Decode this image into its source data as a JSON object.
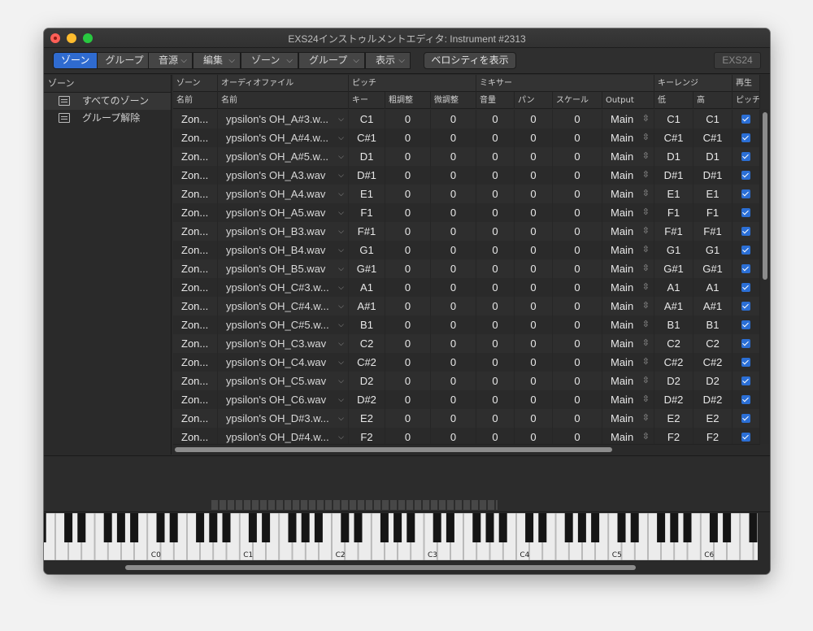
{
  "window": {
    "title": "EXS24インストゥルメントエディタ: Instrument #2313"
  },
  "toolbar": {
    "mode_tabs": [
      {
        "label": "ゾーン",
        "active": true
      },
      {
        "label": "グループ",
        "active": false
      }
    ],
    "menus": [
      "音源",
      "編集",
      "ゾーン",
      "グループ",
      "表示"
    ],
    "velocity_button": "ベロシティを表示",
    "exs_button": "EXS24"
  },
  "sidebar": {
    "header": "ゾーン",
    "items": [
      {
        "label": "すべてのゾーン",
        "icon": "zones-icon",
        "selected": true
      },
      {
        "label": "グループ解除",
        "icon": "ungrouped-icon",
        "selected": false
      }
    ]
  },
  "table": {
    "group_headers": [
      "ゾーン",
      "オーディオファイル",
      "ピッチ",
      "ミキサー",
      "キーレンジ",
      "再生"
    ],
    "column_headers": [
      "名前",
      "名前",
      "キー",
      "粗調整",
      "微調整",
      "音量",
      "パン",
      "スケール",
      "Output",
      "低",
      "高",
      "ピッチ"
    ],
    "rows": [
      {
        "zone": "Zon...",
        "file": "ypsilon's OH_A#3.w...",
        "key": "C1",
        "coarse": "0",
        "fine": "0",
        "volume": "0",
        "pan": "0",
        "scale": "0",
        "output": "Main",
        "low": "C1",
        "high": "C1",
        "pitch": true
      },
      {
        "zone": "Zon...",
        "file": "ypsilon's OH_A#4.w...",
        "key": "C#1",
        "coarse": "0",
        "fine": "0",
        "volume": "0",
        "pan": "0",
        "scale": "0",
        "output": "Main",
        "low": "C#1",
        "high": "C#1",
        "pitch": true
      },
      {
        "zone": "Zon...",
        "file": "ypsilon's OH_A#5.w...",
        "key": "D1",
        "coarse": "0",
        "fine": "0",
        "volume": "0",
        "pan": "0",
        "scale": "0",
        "output": "Main",
        "low": "D1",
        "high": "D1",
        "pitch": true
      },
      {
        "zone": "Zon...",
        "file": "ypsilon's OH_A3.wav",
        "key": "D#1",
        "coarse": "0",
        "fine": "0",
        "volume": "0",
        "pan": "0",
        "scale": "0",
        "output": "Main",
        "low": "D#1",
        "high": "D#1",
        "pitch": true
      },
      {
        "zone": "Zon...",
        "file": "ypsilon's OH_A4.wav",
        "key": "E1",
        "coarse": "0",
        "fine": "0",
        "volume": "0",
        "pan": "0",
        "scale": "0",
        "output": "Main",
        "low": "E1",
        "high": "E1",
        "pitch": true
      },
      {
        "zone": "Zon...",
        "file": "ypsilon's OH_A5.wav",
        "key": "F1",
        "coarse": "0",
        "fine": "0",
        "volume": "0",
        "pan": "0",
        "scale": "0",
        "output": "Main",
        "low": "F1",
        "high": "F1",
        "pitch": true
      },
      {
        "zone": "Zon...",
        "file": "ypsilon's OH_B3.wav",
        "key": "F#1",
        "coarse": "0",
        "fine": "0",
        "volume": "0",
        "pan": "0",
        "scale": "0",
        "output": "Main",
        "low": "F#1",
        "high": "F#1",
        "pitch": true
      },
      {
        "zone": "Zon...",
        "file": "ypsilon's OH_B4.wav",
        "key": "G1",
        "coarse": "0",
        "fine": "0",
        "volume": "0",
        "pan": "0",
        "scale": "0",
        "output": "Main",
        "low": "G1",
        "high": "G1",
        "pitch": true
      },
      {
        "zone": "Zon...",
        "file": "ypsilon's OH_B5.wav",
        "key": "G#1",
        "coarse": "0",
        "fine": "0",
        "volume": "0",
        "pan": "0",
        "scale": "0",
        "output": "Main",
        "low": "G#1",
        "high": "G#1",
        "pitch": true
      },
      {
        "zone": "Zon...",
        "file": "ypsilon's OH_C#3.w...",
        "key": "A1",
        "coarse": "0",
        "fine": "0",
        "volume": "0",
        "pan": "0",
        "scale": "0",
        "output": "Main",
        "low": "A1",
        "high": "A1",
        "pitch": true
      },
      {
        "zone": "Zon...",
        "file": "ypsilon's OH_C#4.w...",
        "key": "A#1",
        "coarse": "0",
        "fine": "0",
        "volume": "0",
        "pan": "0",
        "scale": "0",
        "output": "Main",
        "low": "A#1",
        "high": "A#1",
        "pitch": true
      },
      {
        "zone": "Zon...",
        "file": "ypsilon's OH_C#5.w...",
        "key": "B1",
        "coarse": "0",
        "fine": "0",
        "volume": "0",
        "pan": "0",
        "scale": "0",
        "output": "Main",
        "low": "B1",
        "high": "B1",
        "pitch": true
      },
      {
        "zone": "Zon...",
        "file": "ypsilon's OH_C3.wav",
        "key": "C2",
        "coarse": "0",
        "fine": "0",
        "volume": "0",
        "pan": "0",
        "scale": "0",
        "output": "Main",
        "low": "C2",
        "high": "C2",
        "pitch": true
      },
      {
        "zone": "Zon...",
        "file": "ypsilon's OH_C4.wav",
        "key": "C#2",
        "coarse": "0",
        "fine": "0",
        "volume": "0",
        "pan": "0",
        "scale": "0",
        "output": "Main",
        "low": "C#2",
        "high": "C#2",
        "pitch": true
      },
      {
        "zone": "Zon...",
        "file": "ypsilon's OH_C5.wav",
        "key": "D2",
        "coarse": "0",
        "fine": "0",
        "volume": "0",
        "pan": "0",
        "scale": "0",
        "output": "Main",
        "low": "D2",
        "high": "D2",
        "pitch": true
      },
      {
        "zone": "Zon...",
        "file": "ypsilon's OH_C6.wav",
        "key": "D#2",
        "coarse": "0",
        "fine": "0",
        "volume": "0",
        "pan": "0",
        "scale": "0",
        "output": "Main",
        "low": "D#2",
        "high": "D#2",
        "pitch": true
      },
      {
        "zone": "Zon...",
        "file": "ypsilon's OH_D#3.w...",
        "key": "E2",
        "coarse": "0",
        "fine": "0",
        "volume": "0",
        "pan": "0",
        "scale": "0",
        "output": "Main",
        "low": "E2",
        "high": "E2",
        "pitch": true
      },
      {
        "zone": "Zon...",
        "file": "ypsilon's OH_D#4.w...",
        "key": "F2",
        "coarse": "0",
        "fine": "0",
        "volume": "0",
        "pan": "0",
        "scale": "0",
        "output": "Main",
        "low": "F2",
        "high": "F2",
        "pitch": true
      }
    ]
  },
  "keyboard": {
    "octave_labels": [
      "C0",
      "C1",
      "C2",
      "C3",
      "C4",
      "C5",
      "C6"
    ]
  },
  "colors": {
    "accent": "#2f6bd0",
    "checkbox": "#2b6fd6",
    "background": "#2b2b2b"
  }
}
